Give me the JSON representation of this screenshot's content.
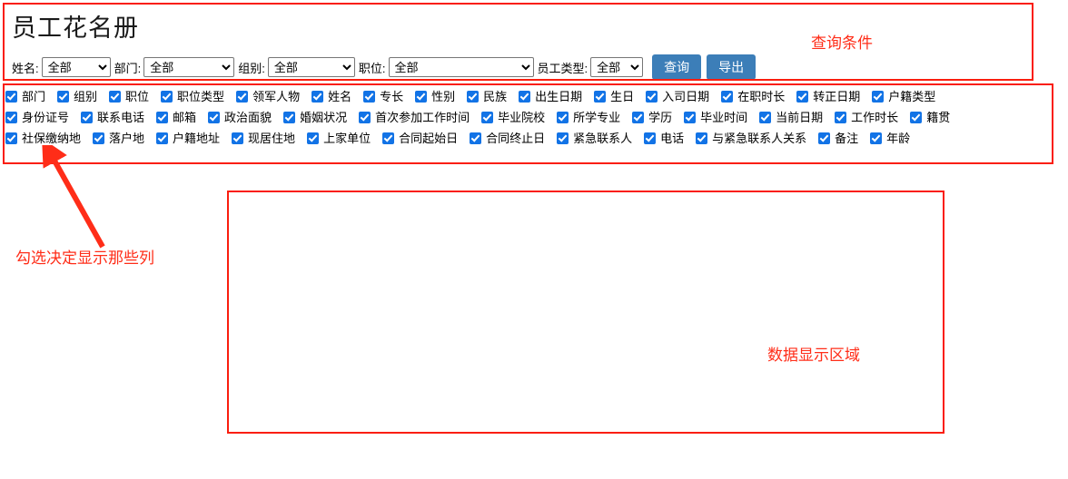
{
  "header": {
    "title": "员工花名册"
  },
  "filters": [
    {
      "label": "姓名:",
      "value": "全部",
      "name": "name"
    },
    {
      "label": "部门:",
      "value": "全部",
      "name": "dept"
    },
    {
      "label": "组别:",
      "value": "全部",
      "name": "group"
    },
    {
      "label": "职位:",
      "value": "全部",
      "name": "position"
    },
    {
      "label": "员工类型:",
      "value": "全部",
      "name": "emptype"
    }
  ],
  "buttons": {
    "query": "查询",
    "export": "导出",
    "accent_color": "#3c7eb8"
  },
  "columns": {
    "checkbox_color": "#1273e6",
    "rows": [
      [
        "部门",
        "组别",
        "职位",
        "职位类型",
        "领军人物",
        "姓名",
        "专长",
        "性别",
        "民族",
        "出生日期",
        "生日",
        "入司日期",
        "在职时长",
        "转正日期",
        "户籍类型"
      ],
      [
        "身份证号",
        "联系电话",
        "邮箱",
        "政治面貌",
        "婚姻状况",
        "首次参加工作时间",
        "毕业院校",
        "所学专业",
        "学历",
        "毕业时间",
        "当前日期",
        "工作时长",
        "籍贯"
      ],
      [
        "社保缴纳地",
        "落户地",
        "户籍地址",
        "现居住地",
        "上家单位",
        "合同起始日",
        "合同终止日",
        "紧急联系人",
        "电话",
        "与紧急联系人关系",
        "备注",
        "年龄"
      ]
    ]
  },
  "annotations": {
    "query_conditions": "查询条件",
    "columns_hint": "勾选决定显示那些列",
    "data_area": "数据显示区域",
    "color": "#ff2d18"
  }
}
